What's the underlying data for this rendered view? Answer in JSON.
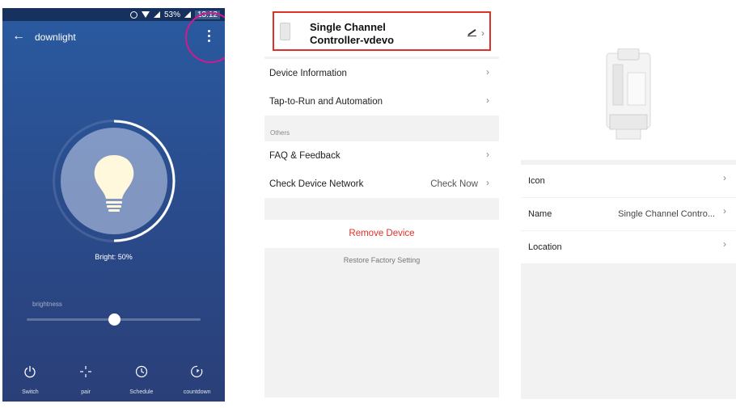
{
  "status_bar": {
    "battery": "53%",
    "time": "13:12"
  },
  "panel1": {
    "title": "downlight",
    "brightness_readout": "Bright: 50%",
    "brightness_label": "brightness",
    "brightness_value": 0.5,
    "bottom_nav": [
      {
        "label": "Switch",
        "icon": "power-icon"
      },
      {
        "label": "pair",
        "icon": "pair-icon"
      },
      {
        "label": "Schedule",
        "icon": "clock-icon"
      },
      {
        "label": "countdown",
        "icon": "countdown-icon"
      }
    ]
  },
  "panel2": {
    "device_name_line1": "Single Channel",
    "device_name_line2": "Controller-vdevo",
    "rows": [
      {
        "label": "Device Information"
      },
      {
        "label": "Tap-to-Run and Automation"
      }
    ],
    "section_others": "Others",
    "rows2": [
      {
        "label": "FAQ & Feedback"
      },
      {
        "label": "Check Device Network",
        "value": "Check Now"
      }
    ],
    "remove_label": "Remove Device",
    "restore_label": "Restore Factory Setting",
    "accent_red": "#e0302a"
  },
  "panel3": {
    "rows": [
      {
        "label": "Icon",
        "value": ""
      },
      {
        "label": "Name",
        "value": "Single Channel Contro..."
      },
      {
        "label": "Location",
        "value": ""
      }
    ]
  },
  "colors": {
    "panel1_bg": "#2a4d8e",
    "highlight_circle": "#d11a8c"
  }
}
